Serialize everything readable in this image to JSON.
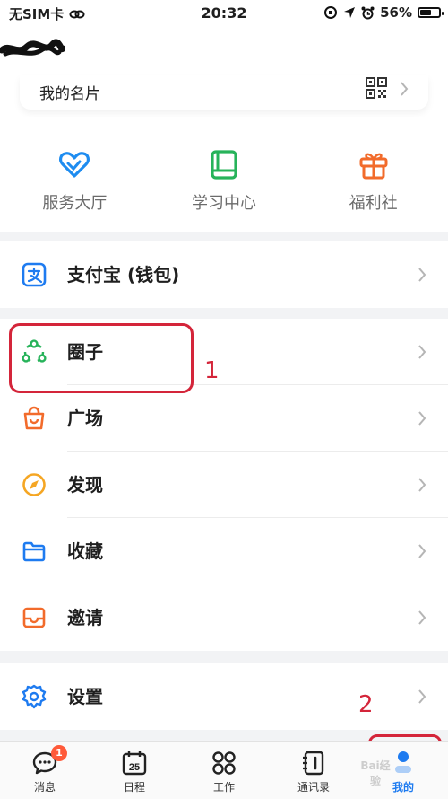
{
  "status_bar": {
    "carrier": "无SIM卡",
    "time": "20:32",
    "battery": "56%"
  },
  "namecard": {
    "label": "我的名片"
  },
  "quick_grid": [
    {
      "label": "服务大厅",
      "icon": "heart-icon",
      "color": "#1e8cf0"
    },
    {
      "label": "学习中心",
      "icon": "book-icon",
      "color": "#27b35a"
    },
    {
      "label": "福利社",
      "icon": "gift-icon",
      "color": "#f26b2b"
    }
  ],
  "menu": {
    "alipay": {
      "label": "支付宝 (钱包)",
      "icon": "alipay-icon",
      "color": "#1e7bf0"
    },
    "circle": {
      "label": "圈子",
      "icon": "circle-network-icon",
      "color": "#27b35a"
    },
    "square": {
      "label": "广场",
      "icon": "shopping-bag-icon",
      "color": "#f26b2b"
    },
    "discover": {
      "label": "发现",
      "icon": "compass-icon",
      "color": "#f5a623"
    },
    "favorites": {
      "label": "收藏",
      "icon": "folder-icon",
      "color": "#1e7bf0"
    },
    "invite": {
      "label": "邀请",
      "icon": "inbox-icon",
      "color": "#f26b2b"
    },
    "settings": {
      "label": "设置",
      "icon": "gear-icon",
      "color": "#1e7bf0"
    }
  },
  "annotations": {
    "step1": "1",
    "step2": "2"
  },
  "tabbar": {
    "messages": {
      "label": "消息",
      "badge": "1"
    },
    "calendar": {
      "label": "日程",
      "day": "25"
    },
    "work": {
      "label": "工作"
    },
    "contacts": {
      "label": "通讯录"
    },
    "me": {
      "label": "我的"
    }
  },
  "watermark": "Bai经验",
  "accent_color": "#1e7bf0",
  "annotation_color": "#d4253a"
}
